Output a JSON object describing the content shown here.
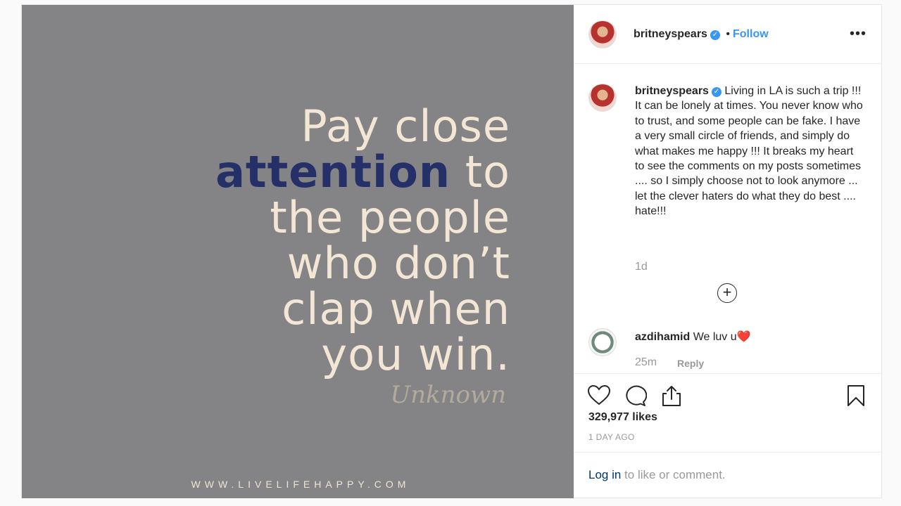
{
  "media": {
    "quote_lines": [
      "Pay close",
      "to",
      "the people",
      "who don’t",
      "clap when",
      "you win."
    ],
    "quote_highlight": "attention",
    "attribution": "Unknown",
    "site": "WWW.LIVELIFEHAPPY.COM",
    "colors": {
      "background": "#848486",
      "text": "#f3e6d4",
      "highlight": "#243067"
    }
  },
  "header": {
    "username": "britneyspears",
    "verified_icon": "verified-badge-icon",
    "separator": "•",
    "follow_label": "Follow",
    "more_label": "•••"
  },
  "caption": {
    "username": "britneyspears",
    "text": "Living in LA is such a trip !!! It can be lonely at times. You never know who to trust, and some people can be fake. I have a very small circle of friends, and simply do what makes me happy !!! It breaks my heart to see the comments on my posts sometimes .... so I simply choose not to look anymore ... let the clever haters do what they do best .... hate!!!",
    "time": "1d"
  },
  "load_more": {
    "icon": "plus-circle-icon",
    "symbol": "+"
  },
  "comments": [
    {
      "username": "azdihamid",
      "text": "We luv u",
      "emoji": "❤️",
      "time": "25m",
      "reply_label": "Reply"
    }
  ],
  "actions": {
    "icons": [
      "heart-icon",
      "comment-icon",
      "share-icon",
      "bookmark-icon"
    ],
    "likes": "329,977 likes",
    "posted_ago": "1 DAY AGO"
  },
  "login": {
    "link": "Log in",
    "rest": " to like or comment."
  },
  "colors": {
    "accent": "#3897f0",
    "muted": "#999999",
    "text": "#262626"
  }
}
